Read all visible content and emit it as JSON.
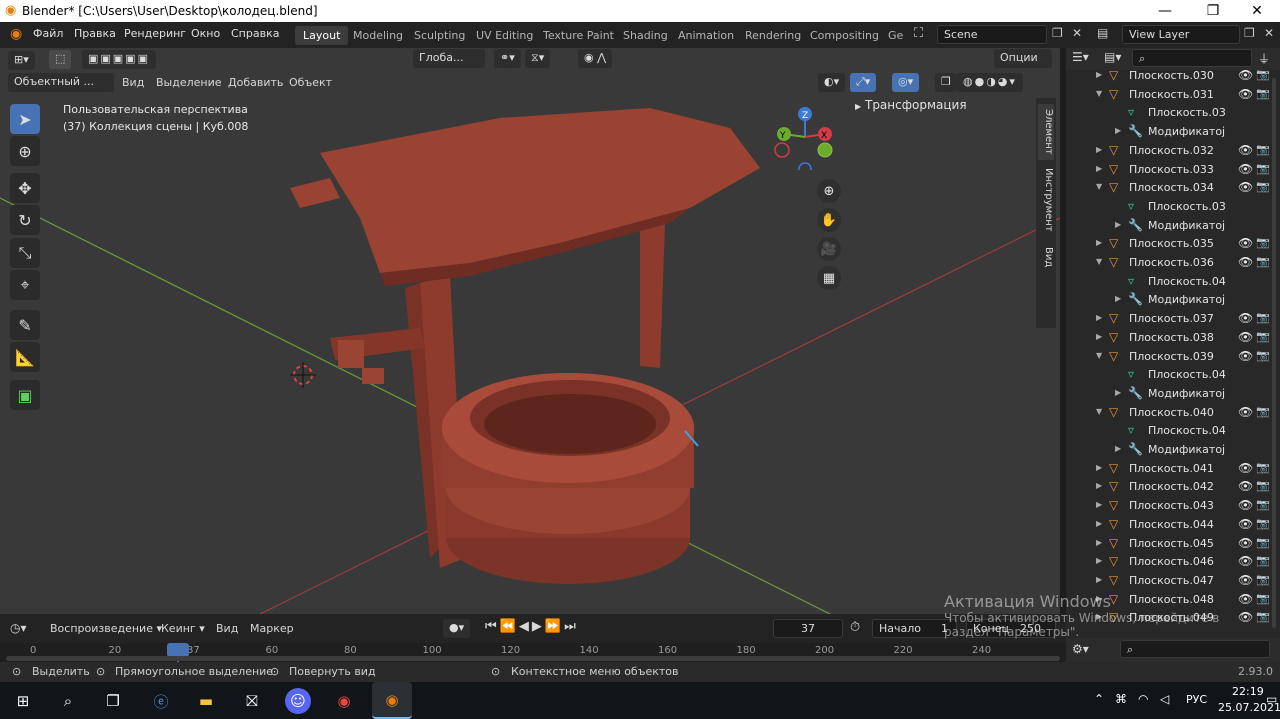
{
  "window": {
    "title": "Blender* [C:\\Users\\User\\Desktop\\колодец.blend]",
    "minimize": "—",
    "maximize": "❐",
    "close": "✕"
  },
  "menu": [
    "Файл",
    "Правка",
    "Рендеринг",
    "Окно",
    "Справка"
  ],
  "workspaces": [
    "Layout",
    "Modeling",
    "Sculpting",
    "UV Editing",
    "Texture Paint",
    "Shading",
    "Animation",
    "Rendering",
    "Compositing",
    "Ge"
  ],
  "scene": {
    "name": "Scene",
    "view_layer": "View Layer"
  },
  "viewport_header": {
    "mode": "Объектный ...",
    "view": "Вид",
    "select": "Выделение",
    "add": "Добавить",
    "object": "Объект",
    "transform": "Глоба...",
    "options": "Опции"
  },
  "viewport_info": {
    "line1": "Пользовательская перспектива",
    "line2": "(37) Коллекция сцены | Куб.008"
  },
  "sidebar": {
    "transform_label": "Трансформация",
    "tabs": [
      "Элемент",
      "Инструмент",
      "Вид"
    ]
  },
  "gizmo": {
    "x": "X",
    "y": "Y",
    "z": "Z"
  },
  "tools": [
    "select-box",
    "cursor",
    "move",
    "rotate",
    "scale",
    "transform",
    "annotate",
    "measure",
    "add-cube"
  ],
  "outliner": {
    "rows": [
      {
        "type": "object",
        "label": "Плоскость.030",
        "expanded": false
      },
      {
        "type": "object",
        "label": "Плоскость.031",
        "expanded": true
      },
      {
        "type": "mesh",
        "label": "Плоскость.03"
      },
      {
        "type": "mod",
        "label": "Модификатој"
      },
      {
        "type": "object",
        "label": "Плоскость.032",
        "expanded": false
      },
      {
        "type": "object",
        "label": "Плоскость.033",
        "expanded": false
      },
      {
        "type": "object",
        "label": "Плоскость.034",
        "expanded": true
      },
      {
        "type": "mesh",
        "label": "Плоскость.03"
      },
      {
        "type": "mod",
        "label": "Модификатој"
      },
      {
        "type": "object",
        "label": "Плоскость.035",
        "expanded": false
      },
      {
        "type": "object",
        "label": "Плоскость.036",
        "expanded": true
      },
      {
        "type": "mesh",
        "label": "Плоскость.04"
      },
      {
        "type": "mod",
        "label": "Модификатој"
      },
      {
        "type": "object",
        "label": "Плоскость.037",
        "expanded": false
      },
      {
        "type": "object",
        "label": "Плоскость.038",
        "expanded": false
      },
      {
        "type": "object",
        "label": "Плоскость.039",
        "expanded": true
      },
      {
        "type": "mesh",
        "label": "Плоскость.04"
      },
      {
        "type": "mod",
        "label": "Модификатој"
      },
      {
        "type": "object",
        "label": "Плоскость.040",
        "expanded": true
      },
      {
        "type": "mesh",
        "label": "Плоскость.04"
      },
      {
        "type": "mod",
        "label": "Модификатој"
      },
      {
        "type": "object",
        "label": "Плоскость.041",
        "expanded": false
      },
      {
        "type": "object",
        "label": "Плоскость.042",
        "expanded": false
      },
      {
        "type": "object",
        "label": "Плоскость.043",
        "expanded": false
      },
      {
        "type": "object",
        "label": "Плоскость.044",
        "expanded": false
      },
      {
        "type": "object",
        "label": "Плоскость.045",
        "expanded": false
      },
      {
        "type": "object",
        "label": "Плоскость.046",
        "expanded": false
      },
      {
        "type": "object",
        "label": "Плоскость.047",
        "expanded": false
      },
      {
        "type": "object",
        "label": "Плоскость.048",
        "expanded": false
      },
      {
        "type": "object",
        "label": "Плоскость.049",
        "expanded": false
      }
    ]
  },
  "timeline": {
    "playback": "Воспроизведение",
    "keying": "Кеинг",
    "view": "Вид",
    "marker": "Маркер",
    "current_frame": "37",
    "start_label": "Начало",
    "start": "1",
    "end_label": "Конец",
    "end": "250",
    "ticks": [
      "0",
      "20",
      "37",
      "60",
      "80",
      "100",
      "120",
      "140",
      "160",
      "180",
      "200",
      "220",
      "240"
    ],
    "current_fraction": 0.148
  },
  "statusbar": {
    "select": "Выделить",
    "box_select": "Прямоугольное выделение",
    "rotate_view": "Повернуть вид",
    "context_menu": "Контекстное меню объектов",
    "version": "2.93.0"
  },
  "watermark": {
    "line1": "Активация Windows",
    "line2": "Чтобы активировать Windows, перейдите в",
    "line3": "раздел \"Параметры\"."
  },
  "taskbar": {
    "lang": "РУС",
    "time": "22:19",
    "date": "25.07.2021"
  },
  "colors": {
    "accent": "#4772b3",
    "object_icon": "#e59634",
    "mesh_icon": "#2cc9a3",
    "viewport_bg": "#393939",
    "model": "#8a3a2c"
  }
}
